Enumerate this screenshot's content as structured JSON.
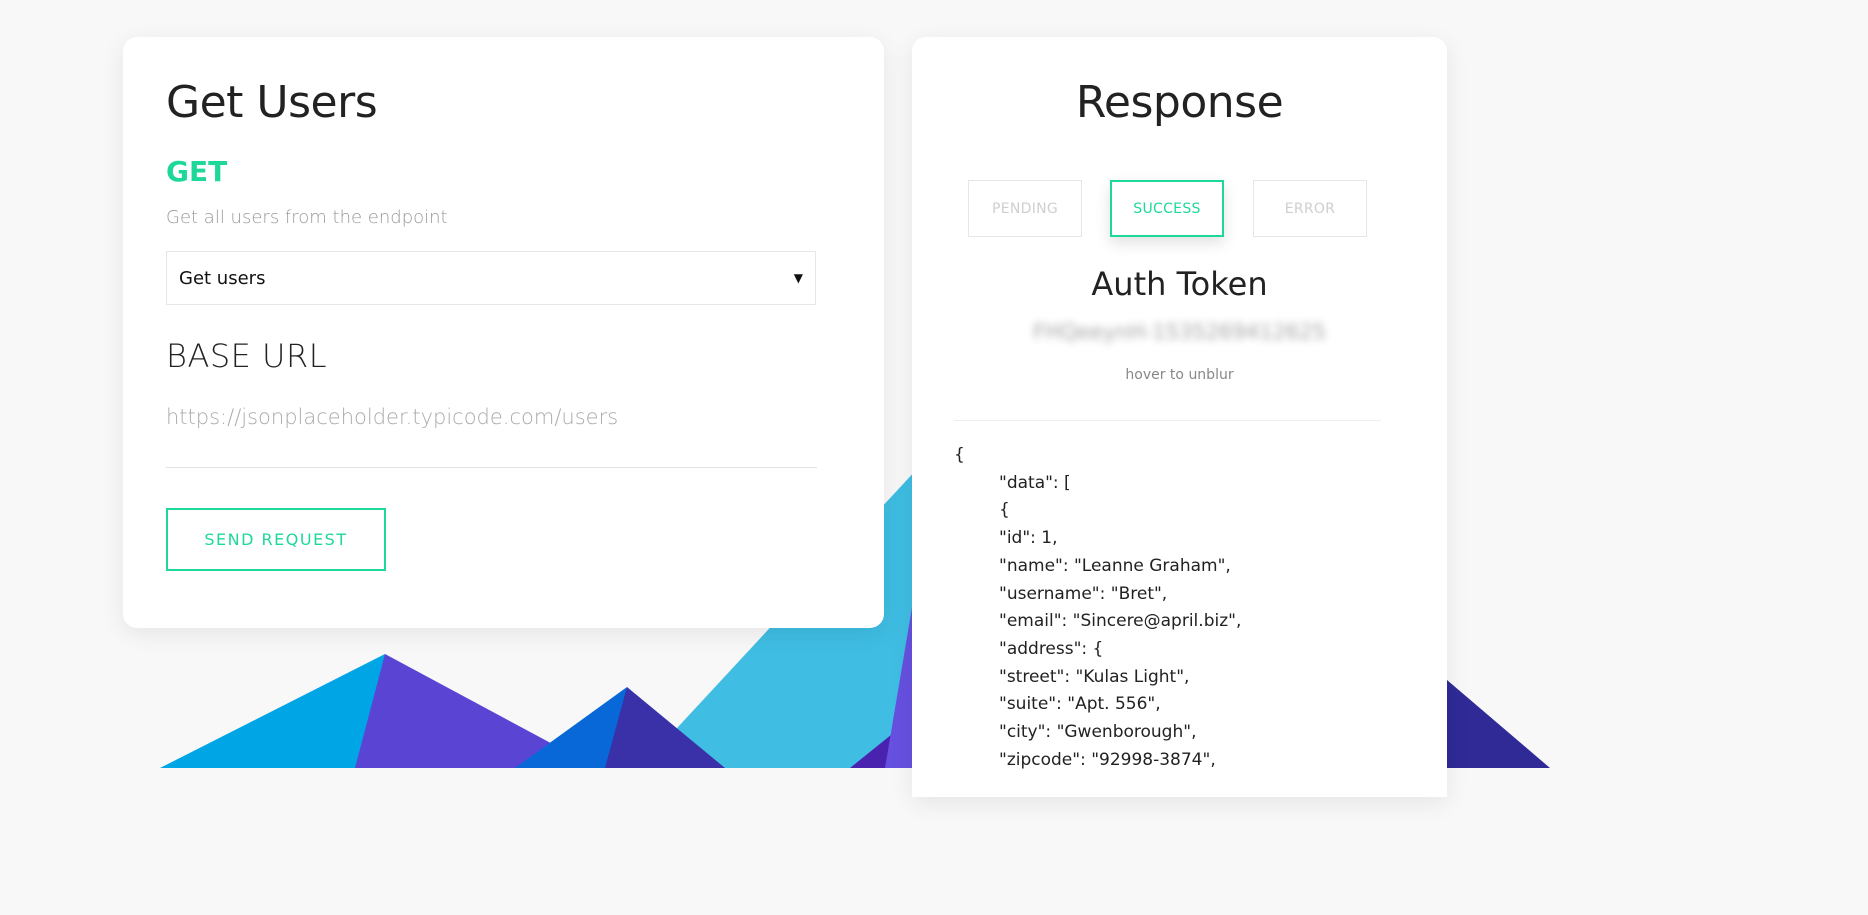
{
  "left_panel": {
    "title": "Get Users",
    "method": "GET",
    "description": "Get all users from the endpoint",
    "select": {
      "selected_value": "Get users"
    },
    "base_url_label": "BASE URL",
    "base_url_value": "https://jsonplaceholder.typicode.com/users",
    "send_button_label": "SEND REQUEST"
  },
  "right_panel": {
    "title": "Response",
    "status_buttons": {
      "pending": "PENDING",
      "success": "SUCCESS",
      "error": "ERROR",
      "active": "success"
    },
    "auth_title": "Auth Token",
    "auth_token": "FHQeeynH-1535269412625",
    "hover_hint": "hover to unblur",
    "response_lines": [
      "{",
      "\"data\": [",
      "{",
      "\"id\": 1,",
      "\"name\": \"Leanne Graham\",",
      "\"username\": \"Bret\",",
      "\"email\": \"Sincere@april.biz\",",
      "\"address\": {",
      "\"street\": \"Kulas Light\",",
      "\"suite\": \"Apt. 556\",",
      "\"city\": \"Gwenborough\",",
      "\"zipcode\": \"92998-3874\","
    ]
  },
  "colors": {
    "accent": "#1ed89a",
    "background": "#f8f8f8",
    "mountain_light_blue": "#3fbde3",
    "mountain_blue": "#00a5e6",
    "mountain_purple": "#5a44d4",
    "mountain_indigo": "#3a30a8",
    "mountain_dark": "#2f2a96"
  }
}
